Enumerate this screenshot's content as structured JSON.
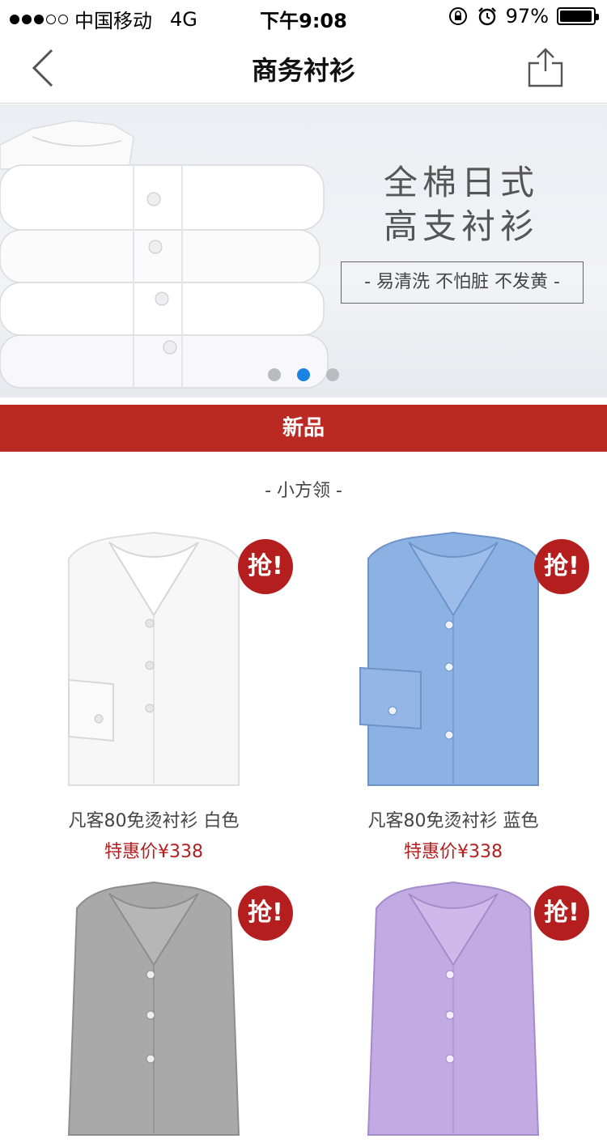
{
  "status_bar": {
    "carrier": "中国移动",
    "network": "4G",
    "time": "下午9:08",
    "battery": "97%",
    "battery_level": 0.97
  },
  "nav": {
    "title": "商务衬衫",
    "back_icon": "chevron-left-icon",
    "share_icon": "share-icon"
  },
  "banner": {
    "headline_line1": "全棉日式",
    "headline_line2": "高支衬衫",
    "tagline": "- 易清洗 不怕脏 不发黄 -",
    "slide_count": 3,
    "active_slide": 2
  },
  "section": {
    "title": "新品",
    "subsection": "- 小方领 -"
  },
  "products": [
    {
      "name": "凡客80免烫衬衫 白色",
      "price": "特惠价¥338",
      "badge": "抢!",
      "color": "#f7f7f7"
    },
    {
      "name": "凡客80免烫衬衫 蓝色",
      "price": "特惠价¥338",
      "badge": "抢!",
      "color": "#8cb1e3"
    },
    {
      "name": "",
      "price": "",
      "badge": "抢!",
      "color": "#a9a9a9"
    },
    {
      "name": "",
      "price": "",
      "badge": "抢!",
      "color": "#c2abe2"
    }
  ],
  "colors": {
    "accent_red": "#bb2a22",
    "price_red": "#b51e1e",
    "dot_active": "#1a82e2"
  }
}
